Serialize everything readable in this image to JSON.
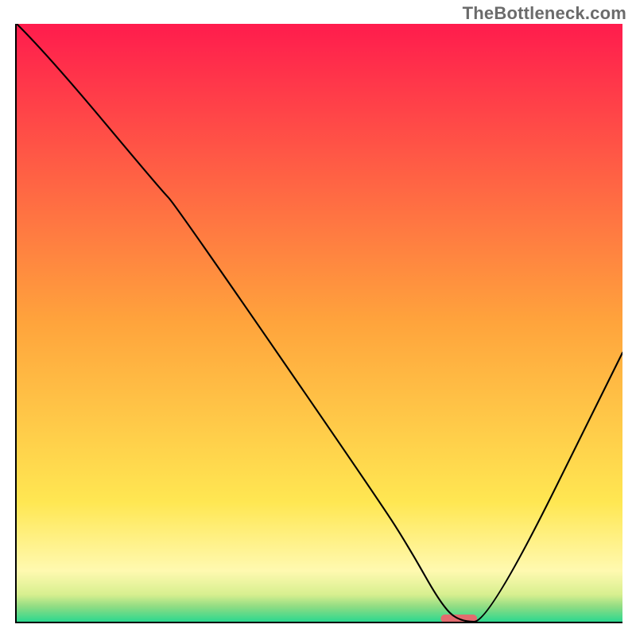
{
  "watermark": "TheBottleneck.com",
  "chart_data": {
    "type": "line",
    "title": "",
    "xlabel": "",
    "ylabel": "",
    "xlim": [
      0,
      100
    ],
    "ylim": [
      0,
      100
    ],
    "series": [
      {
        "name": "curve",
        "x": [
          0,
          5,
          24,
          26,
          60,
          65,
          70,
          73,
          78,
          100
        ],
        "values": [
          100,
          95,
          72,
          70,
          20,
          12,
          3,
          0,
          0,
          45
        ]
      }
    ],
    "marker": {
      "x_start": 70,
      "x_end": 76,
      "y": 0,
      "color": "#e36b6f"
    },
    "background_gradient": [
      {
        "pos": 0.0,
        "color": "#ff1c4d"
      },
      {
        "pos": 0.5,
        "color": "#ffa43c"
      },
      {
        "pos": 0.8,
        "color": "#ffe752"
      },
      {
        "pos": 0.915,
        "color": "#fff9b0"
      },
      {
        "pos": 0.955,
        "color": "#d7ef8f"
      },
      {
        "pos": 0.975,
        "color": "#8fdc83"
      },
      {
        "pos": 1.0,
        "color": "#2cd88f"
      }
    ],
    "legend": null,
    "annotations": []
  }
}
